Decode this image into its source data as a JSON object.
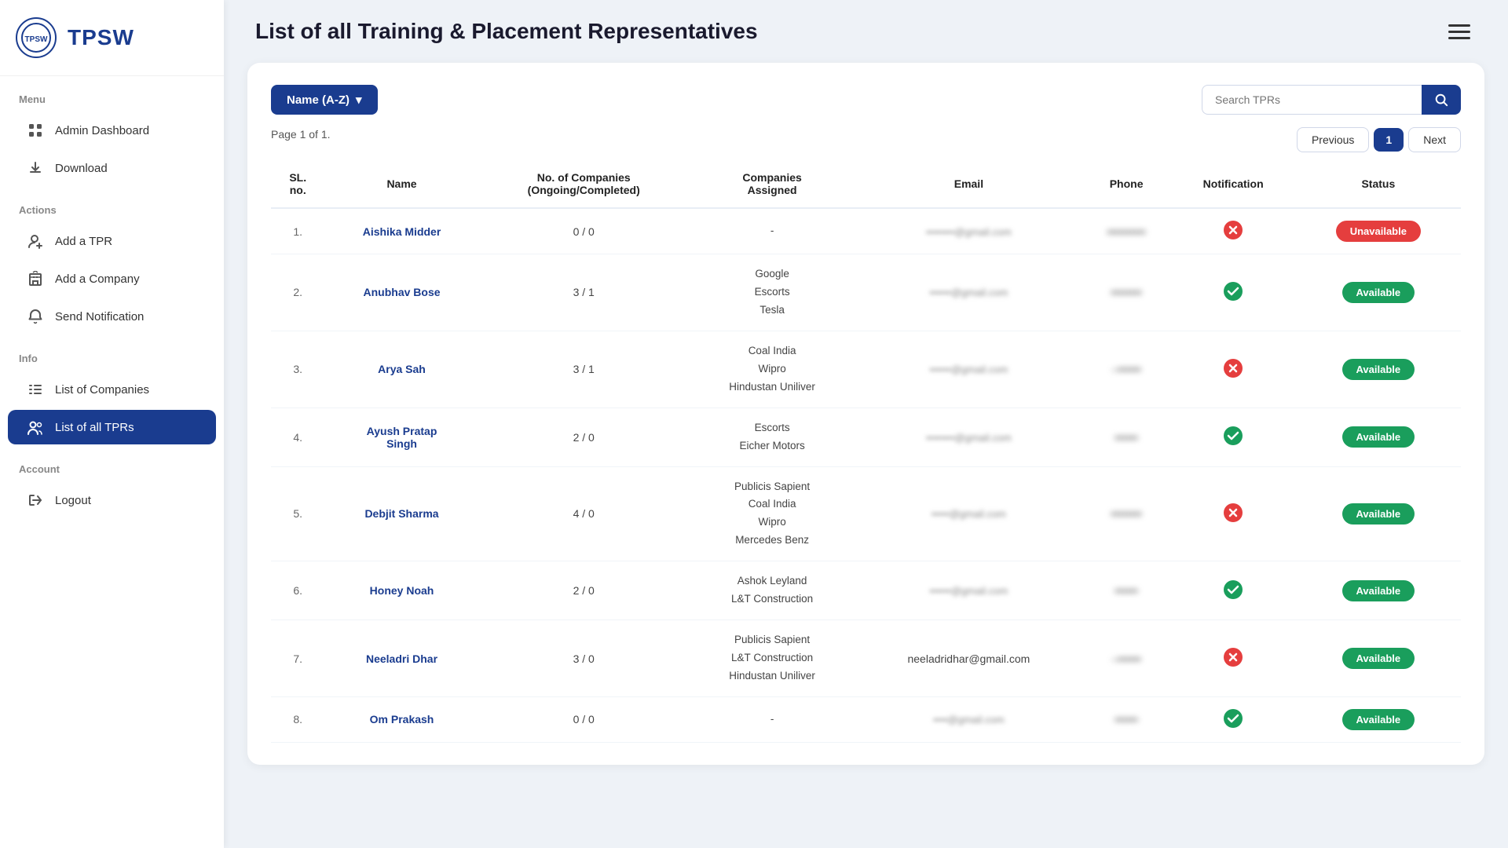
{
  "sidebar": {
    "logo_text": "TPSW",
    "menu_label": "Menu",
    "items_info": [
      {
        "id": "admin-dashboard",
        "label": "Admin Dashboard",
        "icon": "grid",
        "active": false,
        "section": "menu"
      },
      {
        "id": "download",
        "label": "Download",
        "icon": "download",
        "active": false,
        "section": "menu"
      }
    ],
    "actions_label": "Actions",
    "items_actions": [
      {
        "id": "add-tpr",
        "label": "Add a TPR",
        "icon": "person-plus",
        "active": false
      },
      {
        "id": "add-company",
        "label": "Add a Company",
        "icon": "building",
        "active": false
      },
      {
        "id": "send-notification",
        "label": "Send Notification",
        "icon": "bell",
        "active": false
      }
    ],
    "info_label": "Info",
    "items_info2": [
      {
        "id": "list-companies",
        "label": "List of Companies",
        "icon": "list",
        "active": false
      },
      {
        "id": "list-tprs",
        "label": "List of all TPRs",
        "icon": "people",
        "active": true
      }
    ],
    "account_label": "Account",
    "items_account": [
      {
        "id": "logout",
        "label": "Logout",
        "icon": "logout",
        "active": false
      }
    ]
  },
  "page": {
    "title": "List of all Training & Placement Representatives",
    "sort_label": "Name (A-Z)",
    "search_placeholder": "Search TPRs",
    "page_info": "Page 1 of 1.",
    "prev_label": "Previous",
    "next_label": "Next",
    "current_page": "1"
  },
  "table": {
    "columns": [
      "SL. no.",
      "Name",
      "No. of Companies\n(Ongoing/Completed)",
      "Companies\nAssigned",
      "Email",
      "Phone",
      "Notification",
      "Status"
    ],
    "rows": [
      {
        "sl": "1.",
        "name": "Aishika Midder",
        "companies_count": "0 / 0",
        "companies": "-",
        "email": "••••••••@gmail.com",
        "phone": "••••••••••",
        "notification": "cross",
        "status": "Unavailable"
      },
      {
        "sl": "2.",
        "name": "Anubhav Bose",
        "companies_count": "3 / 1",
        "companies": "Google\nEscorts\nTesla",
        "email": "••••••@gmail.com",
        "phone": "••••••••",
        "notification": "check",
        "status": "Available"
      },
      {
        "sl": "3.",
        "name": "Arya Sah",
        "companies_count": "3 / 1",
        "companies": "Coal India\nWipro\nHindustan Uniliver",
        "email": "••••••@gmail.com",
        "phone": "–••••••",
        "notification": "cross",
        "status": "Available"
      },
      {
        "sl": "4.",
        "name": "Ayush Pratap\nSingh",
        "companies_count": "2 / 0",
        "companies": "Escorts\nEicher Motors",
        "email": "••••••••@gmail.com",
        "phone": "••••••",
        "notification": "check",
        "status": "Available"
      },
      {
        "sl": "5.",
        "name": "Debjit Sharma",
        "companies_count": "4 / 0",
        "companies": "Publicis Sapient\nCoal India\nWipro\nMercedes Benz",
        "email": "•••••@gmail.com",
        "phone": "••••••••",
        "notification": "cross",
        "status": "Available"
      },
      {
        "sl": "6.",
        "name": "Honey Noah",
        "companies_count": "2 / 0",
        "companies": "Ashok Leyland\nL&T Construction",
        "email": "••••••@gmail.com",
        "phone": "••••••",
        "notification": "check",
        "status": "Available"
      },
      {
        "sl": "7.",
        "name": "Neeladri Dhar",
        "companies_count": "3 / 0",
        "companies": "Publicis Sapient\nL&T Construction\nHindustan Uniliver",
        "email": "neeladridhar@gmail.com",
        "phone": "–••••••",
        "notification": "cross",
        "status": "Available"
      },
      {
        "sl": "8.",
        "name": "Om Prakash",
        "companies_count": "0 / 0",
        "companies": "-",
        "email": "••••@gmail.com",
        "phone": "••••••",
        "notification": "check",
        "status": "Available"
      }
    ]
  },
  "icons": {
    "grid": "⊞",
    "download": "⬇",
    "person-plus": "👤",
    "building": "🏢",
    "bell": "🔔",
    "list": "☰",
    "people": "👥",
    "logout": "🚪",
    "search": "🔍",
    "hamburger": "☰",
    "dropdown_arrow": "▾"
  }
}
